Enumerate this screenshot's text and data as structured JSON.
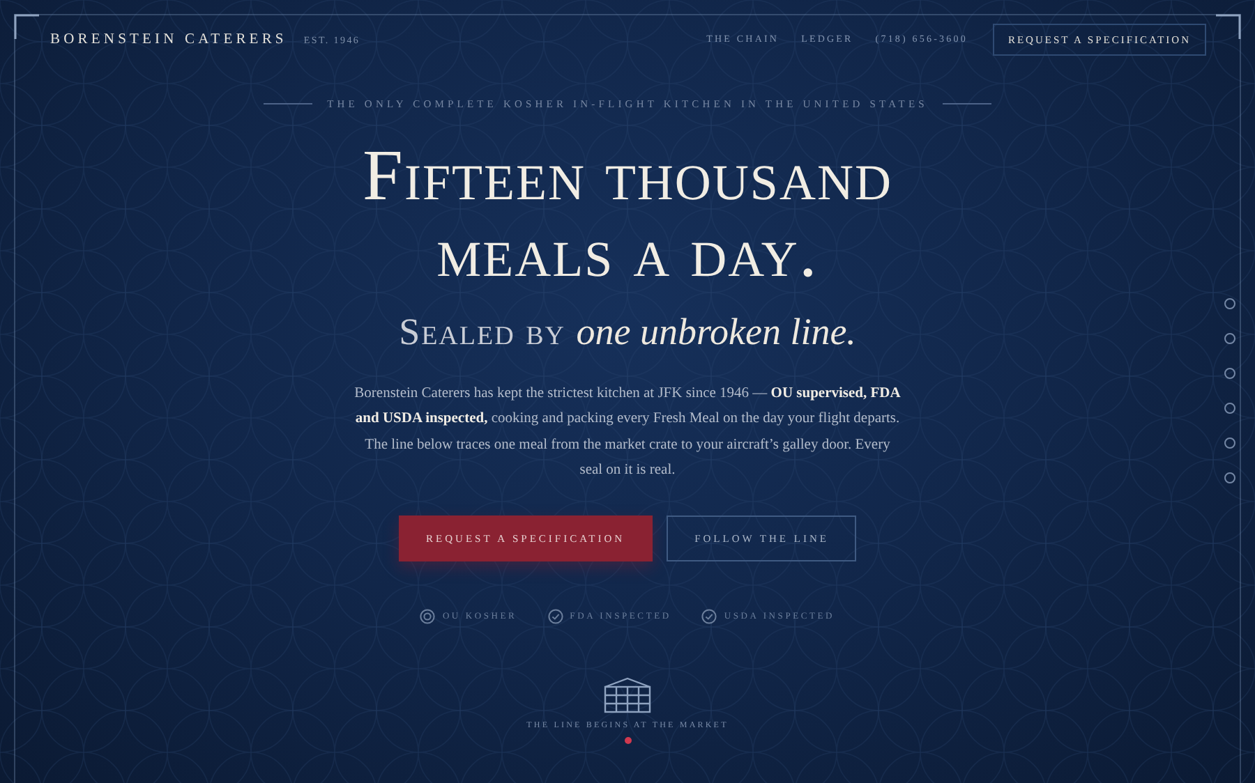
{
  "brand": {
    "name": "BORENSTEIN CATERERS",
    "est": "EST. 1946"
  },
  "nav": {
    "links": [
      "THE CHAIN",
      "LEDGER",
      "(718) 656-3600"
    ],
    "cta": "REQUEST A SPECIFICATION"
  },
  "hero": {
    "eyebrow": "THE ONLY COMPLETE KOSHER IN-FLIGHT KITCHEN IN THE UNITED STATES",
    "headline": [
      "Fifteen thousand",
      "meals a day."
    ],
    "subline": {
      "lead": "Sealed by",
      "emphasis": "one unbroken line."
    },
    "body": "Borenstein Caterers has kept the strictest kitchen at JFK since 1946 — **OU supervised, FDA and USDA inspected,** cooking and packing every Fresh Meal on the day your flight departs. The line below traces one meal from the market crate to your aircraft’s galley door. Every seal on it is real.",
    "buttons": [
      {
        "label": "REQUEST A SPECIFICATION",
        "kind": "primary"
      },
      {
        "label": "FOLLOW THE LINE",
        "kind": "outline"
      }
    ],
    "seals": [
      {
        "label": "OU KOSHER",
        "kind": "ou"
      },
      {
        "label": "FDA INSPECTED",
        "kind": "check"
      },
      {
        "label": "USDA INSPECTED",
        "kind": "check"
      }
    ]
  },
  "scroll_cue": {
    "label": "THE LINE BEGINS AT THE MARKET"
  },
  "side_nav": [
    {
      "selected": false
    },
    {
      "selected": false
    },
    {
      "selected": false
    },
    {
      "selected": false
    },
    {
      "selected": false
    },
    {
      "selected": false
    }
  ]
}
